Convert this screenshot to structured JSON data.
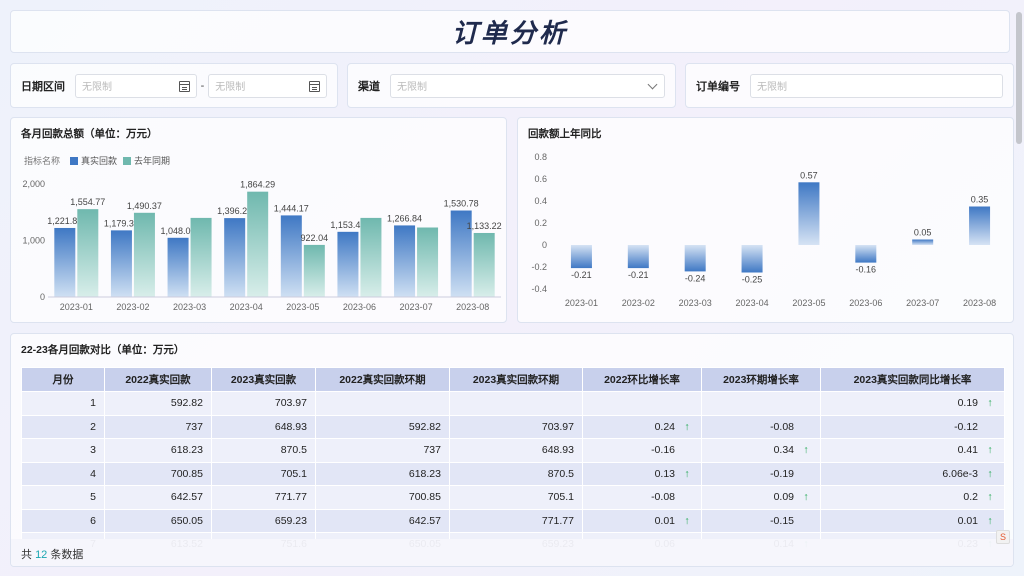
{
  "title": "订单分析",
  "filters": {
    "date_label": "日期区间",
    "date_start_placeholder": "无限制",
    "date_end_placeholder": "无限制",
    "date_separator": "-",
    "channel_label": "渠道",
    "channel_placeholder": "无限制",
    "order_label": "订单编号",
    "order_placeholder": "无限制"
  },
  "monthly_chart": {
    "title": "各月回款总额（单位：万元）",
    "legend_title": "指标名称",
    "legend": [
      "真实回款",
      "去年同期"
    ]
  },
  "yoy_chart": {
    "title": "回款额上年同比"
  },
  "chart_data": [
    {
      "type": "bar",
      "title": "各月回款总额（单位：万元）",
      "categories": [
        "2023-01",
        "2023-02",
        "2023-03",
        "2023-04",
        "2023-05",
        "2023-06",
        "2023-07",
        "2023-08"
      ],
      "series": [
        {
          "name": "真实回款",
          "values": [
            1221.86,
            1179.39,
            1048.0,
            1396.26,
            1444.17,
            1153.48,
            1266.84,
            1530.78
          ],
          "labels": [
            "1,221.86",
            "1,179.39",
            "1,048.00",
            "1,396.26",
            "1,444.17",
            "1,153.48",
            "1,266.84",
            "1,530.78"
          ],
          "color": "#3f78c4"
        },
        {
          "name": "去年同期",
          "values": [
            1554.77,
            1490.37,
            1400,
            1864.29,
            922.04,
            1400,
            1230,
            1133.22
          ],
          "labels": [
            "1,554.77",
            "1,490.37",
            "",
            "1,864.29",
            "922.04",
            "",
            "",
            "1,133.22"
          ],
          "color": "#6fb8ae"
        }
      ],
      "yticks": [
        "0",
        "1,000",
        "2,000"
      ],
      "ylim": [
        0,
        2000
      ]
    },
    {
      "type": "bar",
      "title": "回款额上年同比",
      "categories": [
        "2023-01",
        "2023-02",
        "2023-03",
        "2023-04",
        "2023-05",
        "2023-06",
        "2023-07",
        "2023-08"
      ],
      "values": [
        -0.21,
        -0.21,
        -0.24,
        -0.25,
        0.57,
        -0.16,
        0.05,
        0.35
      ],
      "yticks": [
        "-0.4",
        "-0.2",
        "0",
        "0.2",
        "0.4",
        "0.6",
        "0.8"
      ],
      "ylim": [
        -0.4,
        0.8
      ],
      "color": "#3f78c4"
    }
  ],
  "table": {
    "title": "22-23各月回款对比（单位：万元）",
    "headers": [
      "月份",
      "2022真实回款",
      "2023真实回款",
      "2022真实回款环期",
      "2023真实回款环期",
      "2022环比增长率",
      "2023环期增长率",
      "2023真实回款同比增长率"
    ],
    "rows": [
      {
        "month": "1",
        "r22": "592.82",
        "r23": "703.97",
        "p22": "",
        "p23": "",
        "g22": "",
        "g23": "",
        "yoy": "0.19",
        "g22_up": false,
        "g23_up": false,
        "yoy_up": true
      },
      {
        "month": "2",
        "r22": "737",
        "r23": "648.93",
        "p22": "592.82",
        "p23": "703.97",
        "g22": "0.24",
        "g23": "-0.08",
        "yoy": "-0.12",
        "g22_up": true,
        "g23_up": false,
        "yoy_up": false
      },
      {
        "month": "3",
        "r22": "618.23",
        "r23": "870.5",
        "p22": "737",
        "p23": "648.93",
        "g22": "-0.16",
        "g23": "0.34",
        "yoy": "0.41",
        "g22_up": false,
        "g23_up": true,
        "yoy_up": true
      },
      {
        "month": "4",
        "r22": "700.85",
        "r23": "705.1",
        "p22": "618.23",
        "p23": "870.5",
        "g22": "0.13",
        "g23": "-0.19",
        "yoy": "6.06e-3",
        "g22_up": true,
        "g23_up": false,
        "yoy_up": true
      },
      {
        "month": "5",
        "r22": "642.57",
        "r23": "771.77",
        "p22": "700.85",
        "p23": "705.1",
        "g22": "-0.08",
        "g23": "0.09",
        "yoy": "0.2",
        "g22_up": false,
        "g23_up": true,
        "yoy_up": true
      },
      {
        "month": "6",
        "r22": "650.05",
        "r23": "659.23",
        "p22": "642.57",
        "p23": "771.77",
        "g22": "0.01",
        "g23": "-0.15",
        "yoy": "0.01",
        "g22_up": true,
        "g23_up": false,
        "yoy_up": true
      },
      {
        "month": "7",
        "r22": "613.52",
        "r23": "751.6",
        "p22": "650.05",
        "p23": "659.23",
        "g22": "0.06",
        "g23": "0.14",
        "yoy": "0.23",
        "g22_up": false,
        "g23_up": true,
        "yoy_up": true
      }
    ],
    "footer_prefix": "共",
    "footer_count": "12",
    "footer_suffix": "条数据",
    "up_arrow": "↑"
  },
  "colors": {
    "accent": "#3f78c4",
    "secondary": "#6fb8ae",
    "up": "#22a854",
    "header_bg": "#c8d0ec"
  }
}
